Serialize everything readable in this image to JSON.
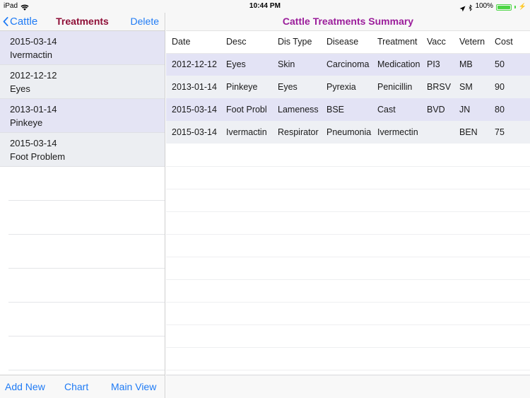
{
  "status_bar": {
    "device": "iPad",
    "wifi_icon": "wifi-icon",
    "time": "10:44 PM",
    "location_icon": "location-arrow-icon",
    "bluetooth_icon": "bluetooth-icon",
    "battery_percent": "100%",
    "battery_icon": "battery-full-icon",
    "charging_icon": "lightning-bolt-icon"
  },
  "left_pane": {
    "nav": {
      "back_label": "Cattle",
      "back_icon": "chevron-left-icon",
      "title": "Treatments",
      "delete_label": "Delete"
    },
    "list": [
      {
        "date": "2015-03-14",
        "desc": "Ivermactin"
      },
      {
        "date": "2012-12-12",
        "desc": "Eyes"
      },
      {
        "date": "2013-01-14",
        "desc": "Pinkeye"
      },
      {
        "date": "2015-03-14",
        "desc": "Foot Problem"
      }
    ],
    "empty_row_count": 6,
    "toolbar": [
      {
        "label": "Add New"
      },
      {
        "label": "Chart"
      },
      {
        "label": "Main View"
      }
    ]
  },
  "right_pane": {
    "title": "Cattle Treatments Summary",
    "table": {
      "columns": [
        "Date",
        "Desc",
        "Dis Type",
        "Disease",
        "Treatment",
        "Vacc",
        "Vetern",
        "Cost"
      ],
      "rows": [
        [
          "2012-12-12",
          "Eyes",
          "Skin",
          "Carcinoma",
          "Medication",
          "PI3",
          "MB",
          "50"
        ],
        [
          "2013-01-14",
          "Pinkeye",
          "Eyes",
          "Pyrexia",
          "Penicillin",
          "BRSV",
          "SM",
          "90"
        ],
        [
          "2015-03-14",
          "Foot Probl",
          "Lameness",
          "BSE",
          "Cast",
          "BVD",
          "JN",
          "80"
        ],
        [
          "2015-03-14",
          "Ivermactin",
          "Respirator",
          "Pneumonia",
          "Ivermectin",
          "",
          "BEN",
          "75"
        ]
      ],
      "blank_row_count": 10
    }
  },
  "colors": {
    "ios_blue": "#1f7bf5",
    "nav_title_maroon": "#8f1038",
    "summary_purple": "#9b1d9b",
    "row_lavender": "#e3e3f5",
    "row_gray": "#eef0f4",
    "battery_green": "#4cd545"
  }
}
